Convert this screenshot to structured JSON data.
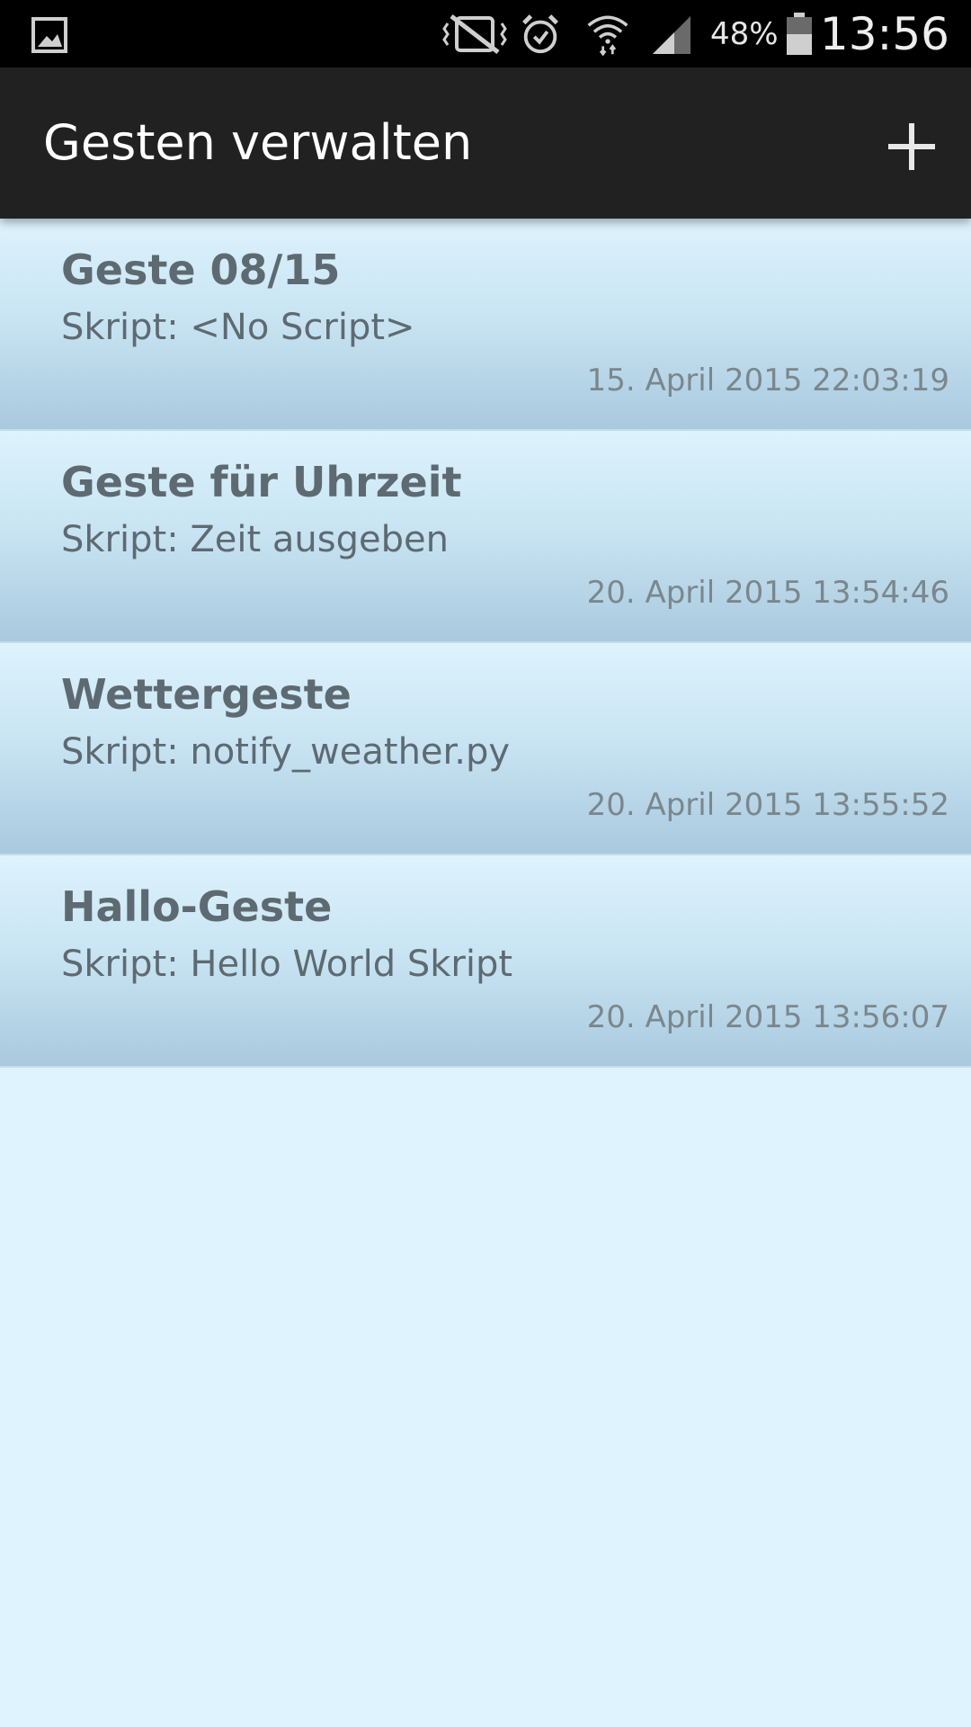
{
  "status_bar": {
    "battery_percent": "48%",
    "time": "13:56",
    "icons": [
      "gallery-icon",
      "vibrate-off-icon",
      "alarm-icon",
      "wifi-icon",
      "signal-icon",
      "battery-icon"
    ]
  },
  "action_bar": {
    "title": "Gesten verwalten",
    "add_icon": "plus-icon"
  },
  "gestures": [
    {
      "name": "Geste 08/15",
      "script": "Skript: <No Script>",
      "date": "15. April 2015 22:03:19"
    },
    {
      "name": "Geste für Uhrzeit",
      "script": "Skript: Zeit ausgeben",
      "date": "20. April 2015 13:54:46"
    },
    {
      "name": "Wettergeste",
      "script": "Skript: notify_weather.py",
      "date": "20. April 2015 13:55:52"
    },
    {
      "name": "Hallo-Geste",
      "script": "Skript: Hello World Skript",
      "date": "20. April 2015 13:56:07"
    }
  ],
  "colors": {
    "status_bar_bg": "#000000",
    "action_bar_bg": "#212121",
    "list_bg": "#def3fd",
    "item_text": "#5e6a72",
    "date_text": "#7b878d"
  }
}
